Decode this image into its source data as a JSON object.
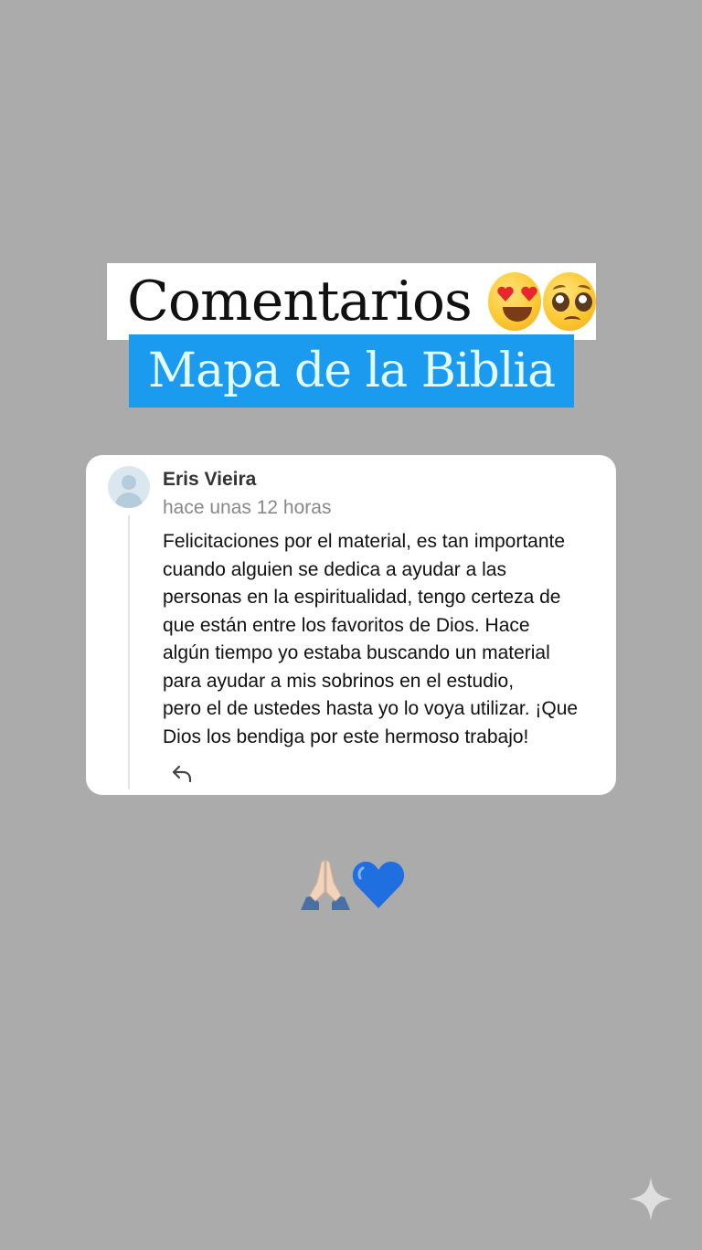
{
  "title": {
    "text": "Comentarios",
    "emojis": [
      "smiling-face-with-heart-eyes",
      "pleading-face"
    ]
  },
  "subtitle": {
    "text": "Mapa de la Biblia",
    "background": "#1a9bf0"
  },
  "comment": {
    "author": "Eris Vieira",
    "time": "hace unas 12 horas",
    "lines": [
      "Felicitaciones por el material, es tan importante",
      "cuando alguien se dedica a ayudar a las",
      "personas en la espiritualidad, tengo certeza de",
      "que están entre los favoritos de Dios. Hace",
      "algún tiempo yo estaba buscando un material",
      "para ayudar a mis sobrinos en el estudio,",
      "pero el de ustedes hasta yo lo voya utilizar. ¡Que",
      "Dios los bendiga por este hermoso trabajo!"
    ],
    "reply_icon": "reply-arrow-icon"
  },
  "bottom_emojis": [
    "folded-hands",
    "blue-heart"
  ],
  "watermark_icon": "sparkle-icon",
  "colors": {
    "background": "#ababab",
    "card": "#ffffff",
    "accent_blue": "#1a9bf0"
  }
}
